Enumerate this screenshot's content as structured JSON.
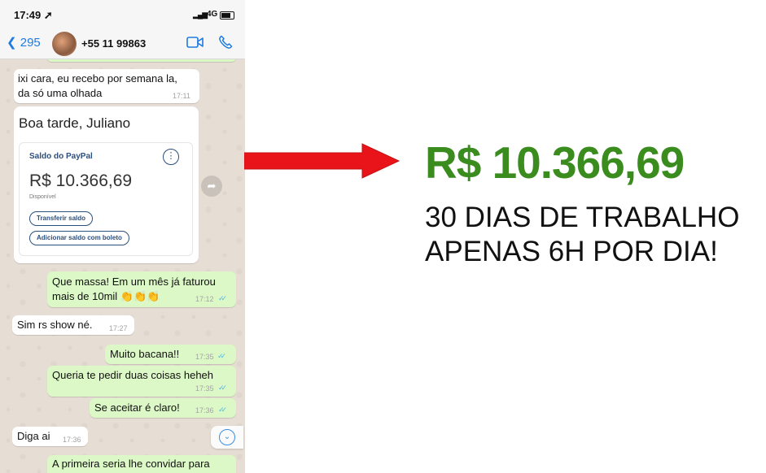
{
  "status": {
    "time": "17:49 ➚",
    "signal": "▂▄▆",
    "network": "4G"
  },
  "header": {
    "back_count": "❮ 295",
    "contact": "+55 11 99863"
  },
  "messages": [
    {
      "text1": "ixi cara, eu recebo por semana la,",
      "text2": "da só uma olhada",
      "time": "17:11"
    },
    {
      "text1": "Que massa! Em um mês já faturou",
      "text2": "mais de 10mil 👏👏👏",
      "time": "17:12"
    },
    {
      "text1": "Sim rs show né.",
      "time": "17:27"
    },
    {
      "text1": "Muito bacana!!",
      "time": "17:35"
    },
    {
      "text1": "Queria te pedir duas coisas heheh",
      "time": "17:35"
    },
    {
      "text1": "Se aceitar é claro!",
      "time": "17:36"
    },
    {
      "text1": "Diga ai",
      "time": "17:36"
    },
    {
      "text1": "A primeira seria lhe convidar para"
    }
  ],
  "ticks": "✓✓",
  "card": {
    "greeting": "Boa tarde, Juliano",
    "title": "Saldo do PayPal",
    "more": "⋮",
    "amount": "R$ 10.366,69",
    "sub": "Disponível",
    "transfer": "Transferir saldo",
    "boleto": "Adicionar saldo com boleto"
  },
  "share_glyph": "➦",
  "scroll_glyph": "⌄",
  "right": {
    "amount": "R$ 10.366,69",
    "line1": "30 DIAS DE TRABALHO",
    "line2": "APENAS 6H POR DIA!"
  },
  "colors": {
    "accent_green": "#3a8c1f",
    "arrow_red": "#e8141a",
    "ios_blue": "#1f7be0",
    "out_bubble": "#dcf8c6"
  },
  "icons": [
    "location-arrow-icon",
    "signal-icon",
    "battery-icon",
    "chevron-left-icon",
    "video-camera-icon",
    "phone-icon",
    "share-icon",
    "chevron-down-icon",
    "clap-emoji-icon",
    "read-ticks-icon",
    "right-arrow-icon"
  ]
}
